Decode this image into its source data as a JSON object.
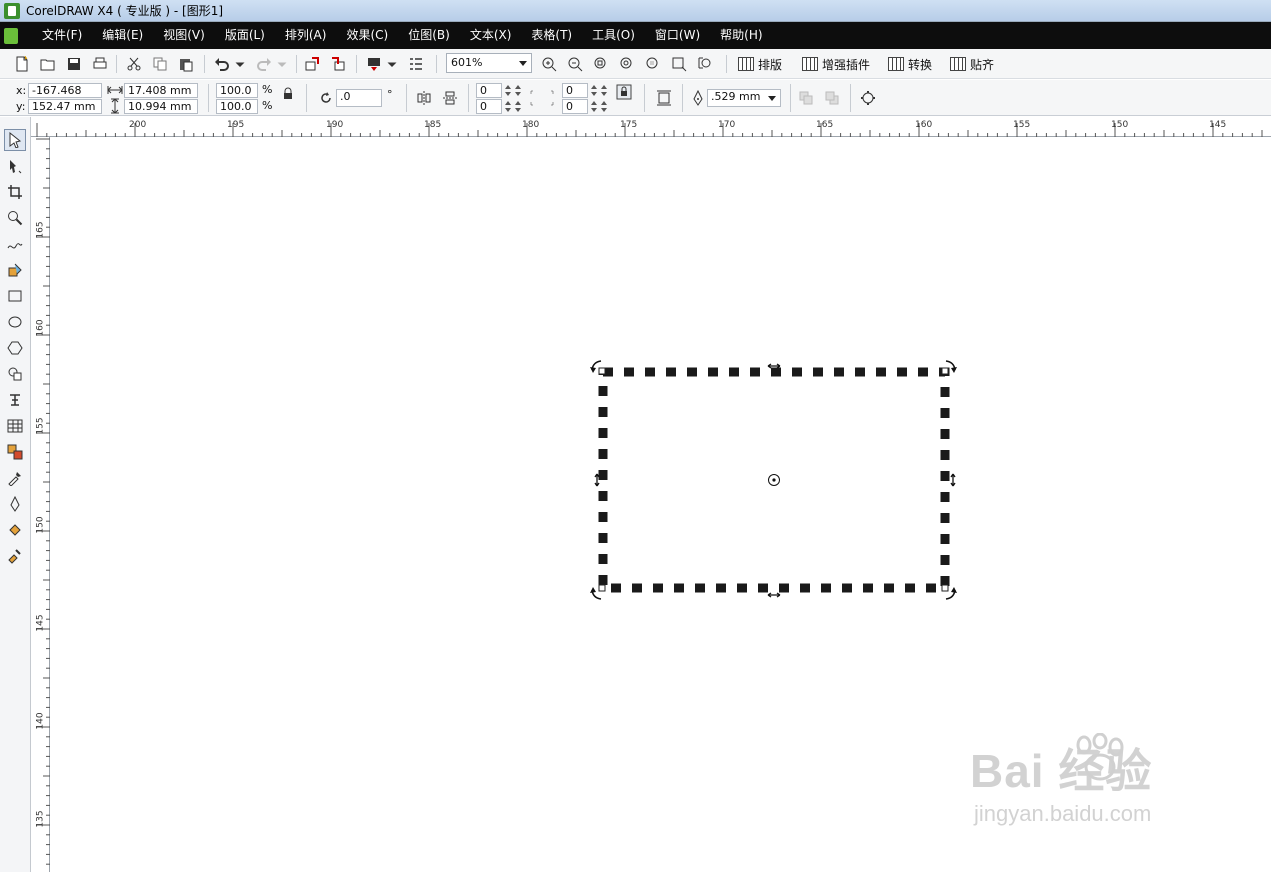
{
  "window": {
    "title": "CorelDRAW X4 ( 专业版 ) - [图形1]"
  },
  "menu": [
    "文件(F)",
    "编辑(E)",
    "视图(V)",
    "版面(L)",
    "排列(A)",
    "效果(C)",
    "位图(B)",
    "文本(X)",
    "表格(T)",
    "工具(O)",
    "窗口(W)",
    "帮助(H)"
  ],
  "toolbar": {
    "zoom": "601%",
    "plugins": [
      "排版",
      "增强插件",
      "转换",
      "贴齐"
    ]
  },
  "property_bar": {
    "x_label": "x:",
    "x_value": "-167.468 mm",
    "y_label": "y:",
    "y_value": "152.47 mm",
    "width_value": "17.408 mm",
    "height_value": "10.994 mm",
    "scale_x": "100.0",
    "scale_y": "100.0",
    "percent": "%",
    "rotation": ".0",
    "degree": "°",
    "corner_1": "0",
    "corner_2": "0",
    "corner_3": "0",
    "corner_4": "0",
    "outline_width": ".529 mm"
  },
  "ruler": {
    "h_labels": [
      "200",
      "195",
      "190",
      "185",
      "180",
      "175",
      "170",
      "165",
      "160",
      "155",
      "150",
      "145"
    ],
    "v_labels": [
      "165",
      "160",
      "155",
      "150",
      "145",
      "140",
      "135"
    ]
  },
  "watermark": {
    "brand": "Bai 经验",
    "url": "jingyan.baidu.com"
  }
}
